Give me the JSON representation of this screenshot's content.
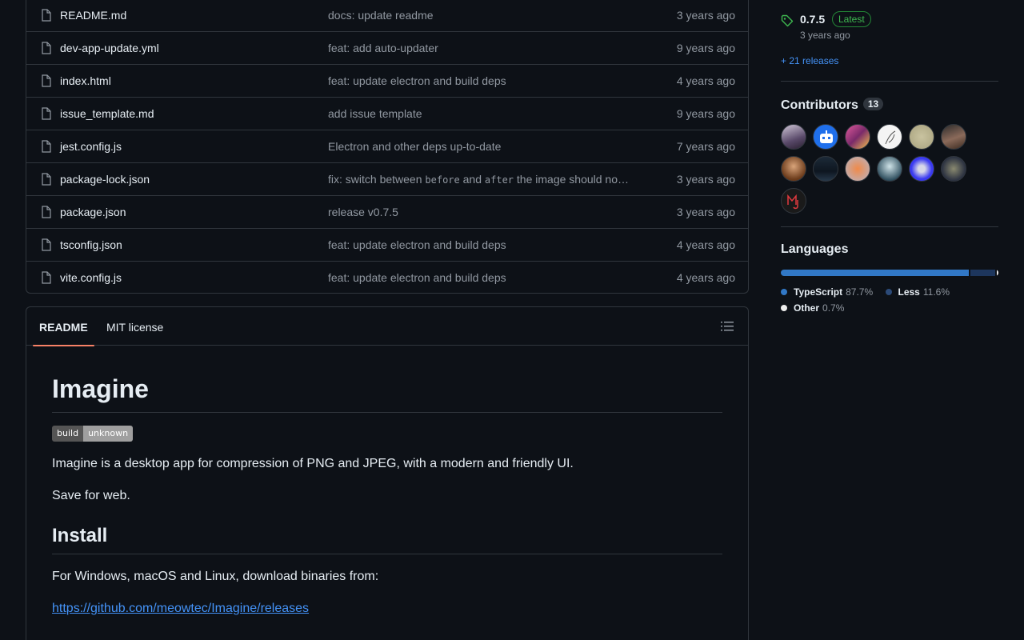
{
  "files": [
    {
      "name": "README.md",
      "msg": "docs: update readme",
      "time": "3 years ago"
    },
    {
      "name": "dev-app-update.yml",
      "msg": "feat: add auto-updater",
      "time": "9 years ago"
    },
    {
      "name": "index.html",
      "msg": "feat: update electron and build deps",
      "time": "4 years ago"
    },
    {
      "name": "issue_template.md",
      "msg": "add issue template",
      "time": "9 years ago"
    },
    {
      "name": "jest.config.js",
      "msg": "Electron and other deps up-to-date",
      "time": "7 years ago"
    },
    {
      "name": "package-lock.json",
      "msg_parts": [
        "fix: switch between ",
        "before",
        " and ",
        "after",
        " the image should no…"
      ],
      "time": "3 years ago"
    },
    {
      "name": "package.json",
      "msg": "release v0.7.5",
      "time": "3 years ago"
    },
    {
      "name": "tsconfig.json",
      "msg": "feat: update electron and build deps",
      "time": "4 years ago"
    },
    {
      "name": "vite.config.js",
      "msg": "feat: update electron and build deps",
      "time": "4 years ago"
    }
  ],
  "readme": {
    "tab_readme": "README",
    "tab_license": "MIT license",
    "h1": "Imagine",
    "badge_left": "build",
    "badge_right": "unknown",
    "p1": "Imagine is a desktop app for compression of PNG and JPEG, with a modern and friendly UI.",
    "p2": "Save for web.",
    "h2": "Install",
    "p3": "For Windows, macOS and Linux, download binaries from:",
    "link": "https://github.com/meowtec/Imagine/releases"
  },
  "sidebar": {
    "release_version": "0.7.5",
    "release_badge": "Latest",
    "release_date": "3 years ago",
    "more_releases": "+ 21 releases",
    "contributors_title": "Contributors",
    "contributors_count": "13",
    "languages_title": "Languages",
    "languages": [
      {
        "name": "TypeScript",
        "pct": "87.7%",
        "value": 87.7,
        "color": "#3178c6"
      },
      {
        "name": "Less",
        "pct": "11.6%",
        "value": 11.6,
        "color": "#1d365d"
      },
      {
        "name": "Other",
        "pct": "0.7%",
        "value": 0.7,
        "color": "#ededed"
      }
    ]
  },
  "colors": {
    "accent": "#4493f8",
    "tab_underline": "#f78166",
    "latest_green": "#3fb950"
  }
}
